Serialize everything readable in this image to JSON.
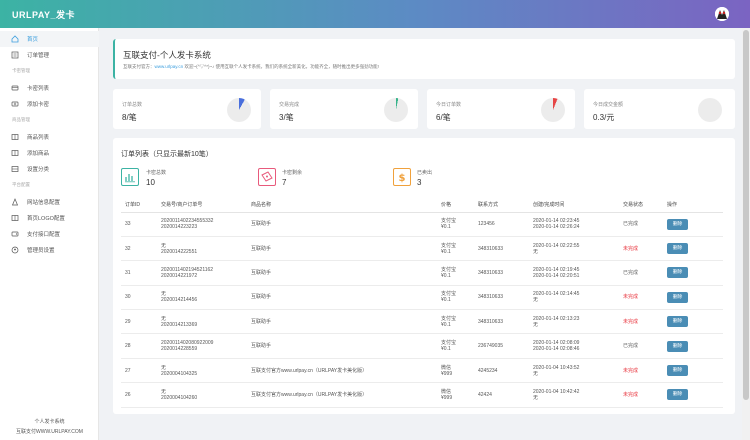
{
  "brand": "URLPAY_发卡",
  "sidebar": {
    "items": [
      {
        "label": "首页",
        "icon": "home-icon",
        "active": true
      },
      {
        "label": "订单管理",
        "icon": "order-icon"
      },
      {
        "label": "卡密列表",
        "icon": "card-list-icon"
      },
      {
        "label": "添加卡密",
        "icon": "add-card-icon"
      },
      {
        "label": "商品列表",
        "icon": "product-list-icon"
      },
      {
        "label": "添加商品",
        "icon": "add-product-icon"
      },
      {
        "label": "设置分类",
        "icon": "category-icon"
      },
      {
        "label": "网站信息配置",
        "icon": "site-config-icon"
      },
      {
        "label": "首页LOGO配置",
        "icon": "logo-config-icon"
      },
      {
        "label": "支付接口配置",
        "icon": "payment-config-icon"
      },
      {
        "label": "管理员设置",
        "icon": "admin-icon"
      }
    ],
    "groups": [
      "卡密管理",
      "商品管理",
      "平台配置"
    ],
    "footer_line1": "个人发卡系统",
    "footer_line2": "互联支付WWW.URLPAY.COM"
  },
  "header": {
    "title": "互联支付-个人发卡系统",
    "sub_prefix": "互联支付官方：",
    "sub_link": "www.urlpay.cn",
    "sub_text": "  欢迎~(^▽^*)~♪ 使用互联个人发卡系统，我们的系统全新美化，功能齐全，随时推出更多强劲功能!"
  },
  "stats": [
    {
      "label": "订单总数",
      "value": "8/笔",
      "fraction": 0.08,
      "color": "#4a6fdc"
    },
    {
      "label": "交易完成",
      "value": "3/笔",
      "fraction": 0.03,
      "color": "#37b38a"
    },
    {
      "label": "今日订单数",
      "value": "6/笔",
      "fraction": 0.06,
      "color": "#e64545"
    },
    {
      "label": "今日成交金额",
      "value": "0.3/元",
      "fraction": 0,
      "color": "#cccccc"
    }
  ],
  "orders": {
    "title": "订单列表（只显示最新10笔）",
    "summary": [
      {
        "label": "卡密总数",
        "value": "10",
        "icon": "chart-icon",
        "color": "#3cb3a4"
      },
      {
        "label": "卡密剩余",
        "value": "7",
        "icon": "ticket-icon",
        "color": "#e85a7c"
      },
      {
        "label": "已卖出",
        "value": "3",
        "icon": "dollar-icon",
        "color": "#f0a13c"
      }
    ],
    "columns": [
      "订单ID",
      "交易号/商户订单号",
      "商品名称",
      "价格",
      "联系方式",
      "创建/完成时间",
      "交易状态",
      "操作"
    ],
    "delete_label": "删除",
    "rows": [
      {
        "id": "33",
        "trade1": "2020011402234555332",
        "trade2": "2020014223223",
        "product": "互联助手",
        "price1": "支付宝",
        "price2": "¥0.1",
        "contact": "123456",
        "time1": "2020-01-14 02:23:45",
        "time2": "2020-01-14 02:26:24",
        "status": "已完成",
        "done": true
      },
      {
        "id": "32",
        "trade1": "无",
        "trade2": "2020014222551",
        "product": "互联助手",
        "price1": "支付宝",
        "price2": "¥0.1",
        "contact": "348310633",
        "time1": "2020-01-14 02:22:55",
        "time2": "无",
        "status": "未完成",
        "done": false
      },
      {
        "id": "31",
        "trade1": "2020011402194521162",
        "trade2": "2020014221972",
        "product": "互联助手",
        "price1": "支付宝",
        "price2": "¥0.1",
        "contact": "348310633",
        "time1": "2020-01-14 02:19:45",
        "time2": "2020-01-14 02:20:51",
        "status": "已完成",
        "done": true
      },
      {
        "id": "30",
        "trade1": "无",
        "trade2": "2020014214456",
        "product": "互联助手",
        "price1": "支付宝",
        "price2": "¥0.1",
        "contact": "348310633",
        "time1": "2020-01-14 02:14:45",
        "time2": "无",
        "status": "未完成",
        "done": false
      },
      {
        "id": "29",
        "trade1": "无",
        "trade2": "2020014213369",
        "product": "互联助手",
        "price1": "支付宝",
        "price2": "¥0.1",
        "contact": "348310633",
        "time1": "2020-01-14 02:13:23",
        "time2": "无",
        "status": "未完成",
        "done": false
      },
      {
        "id": "28",
        "trade1": "2020011402080922009",
        "trade2": "2020014228559",
        "product": "互联助手",
        "price1": "支付宝",
        "price2": "¥0.1",
        "contact": "236749035",
        "time1": "2020-01-14 02:08:09",
        "time2": "2020-01-14 02:08:46",
        "status": "已完成",
        "done": true
      },
      {
        "id": "27",
        "trade1": "无",
        "trade2": "2020004104325",
        "product": "互联支付官方www.urlpay.cn（URLPAY发卡美化版）",
        "price1": "微信",
        "price2": "¥999",
        "contact": "4245234",
        "time1": "2020-01-04 10:43:52",
        "time2": "无",
        "status": "未完成",
        "done": false
      },
      {
        "id": "26",
        "trade1": "无",
        "trade2": "2020004104260",
        "product": "互联支付官方www.urlpay.cn（URLPAY发卡美化版）",
        "price1": "微信",
        "price2": "¥999",
        "contact": "42424",
        "time1": "2020-01-04 10:42:42",
        "time2": "无",
        "status": "未完成",
        "done": false
      }
    ]
  }
}
